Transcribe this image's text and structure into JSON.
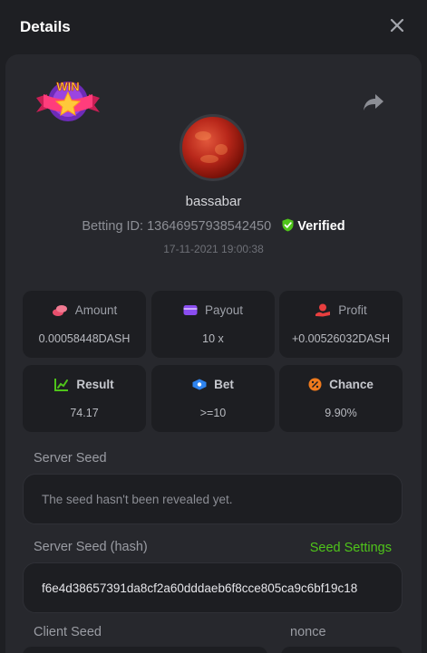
{
  "header": {
    "title": "Details"
  },
  "user": {
    "name": "bassabar",
    "betting_id_label": "Betting ID: 1364695793854245",
    "betting_id_suffix": "0",
    "verified": "Verified",
    "datetime": "17-11-2021 19:00:38"
  },
  "badge": {
    "text": "WIN"
  },
  "stats": [
    {
      "label": "Amount",
      "value": "0.00058448DASH",
      "icon": "coins-icon",
      "color": "#e84f6d"
    },
    {
      "label": "Payout",
      "value": "10 x",
      "icon": "wallet-icon",
      "color": "#8a4df0"
    },
    {
      "label": "Profit",
      "value": "+0.00526032DASH",
      "icon": "hand-coin-icon",
      "color": "#e83f3f"
    },
    {
      "label": "Result",
      "value": "74.17",
      "icon": "chart-icon",
      "color": "#4fc41a"
    },
    {
      "label": "Bet",
      "value": ">=10",
      "icon": "ticket-icon",
      "color": "#2f84ef"
    },
    {
      "label": "Chance",
      "value": "9.90%",
      "icon": "percent-icon",
      "color": "#ef7a1d"
    }
  ],
  "server_seed": {
    "label": "Server Seed",
    "value": "The seed hasn't been revealed yet."
  },
  "server_seed_hash": {
    "label": "Server Seed (hash)",
    "link": "Seed Settings",
    "value": "f6e4d38657391da8cf2a60dddaeb6f8cce805ca9c6bf19c18"
  },
  "client_seed": {
    "label": "Client Seed"
  },
  "nonce": {
    "label": "nonce"
  },
  "colors": {
    "accent_green": "#4fc41a",
    "background": "#1e1f23",
    "card": "#27282d",
    "tile": "#1d1e22"
  }
}
